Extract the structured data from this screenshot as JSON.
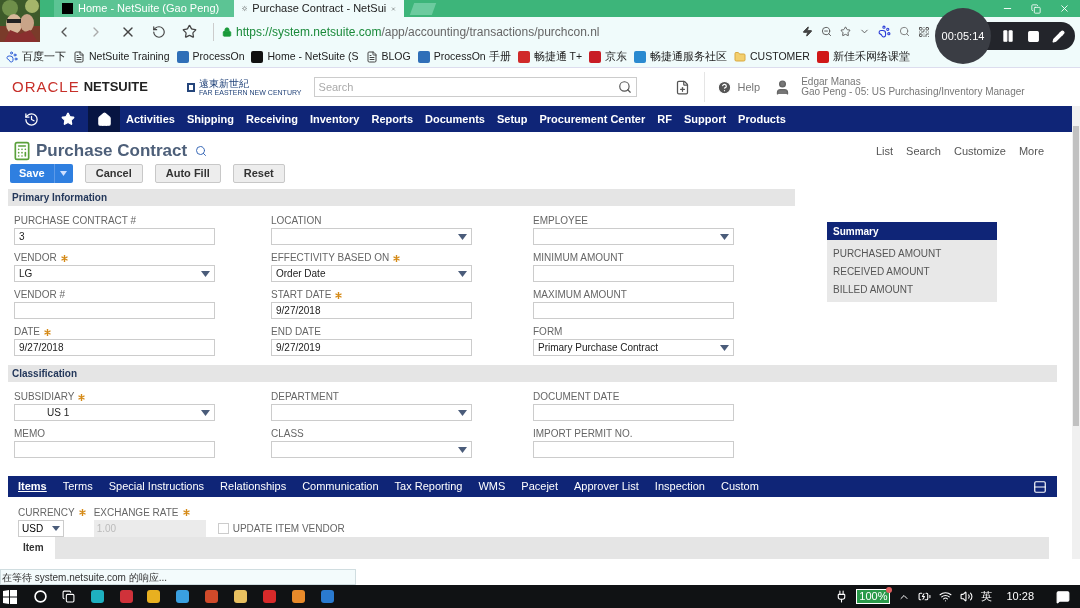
{
  "browser": {
    "tabs": [
      {
        "title": "Home - NetSuite (Gao Peng)",
        "selected": false,
        "loading": false
      },
      {
        "title": "Purchase Contract - NetSui",
        "selected": true,
        "loading": true
      }
    ],
    "url_host": "https://system.netsuite.com",
    "url_path": "/app/accounting/transactions/purchcon.nl",
    "bookmarks": [
      {
        "label": "百度一下",
        "kind": "paw"
      },
      {
        "label": "NetSuite Training",
        "kind": "doc"
      },
      {
        "label": "ProcessOn",
        "kind": "tile",
        "color": "#2f6fb8"
      },
      {
        "label": "Home - NetSuite (S",
        "kind": "tile",
        "color": "#111111"
      },
      {
        "label": "BLOG",
        "kind": "doc"
      },
      {
        "label": "ProcessOn 手册",
        "kind": "tile",
        "color": "#2f6fb8"
      },
      {
        "label": "畅捷通 T+",
        "kind": "tile",
        "color": "#d02a2a"
      },
      {
        "label": "京东",
        "kind": "tile",
        "color": "#c81d25"
      },
      {
        "label": "畅捷通服务社区",
        "kind": "tile",
        "color": "#2a8ad0"
      },
      {
        "label": "CUSTOMER",
        "kind": "folder"
      },
      {
        "label": "新佳禾网络课堂",
        "kind": "tile",
        "color": "#d01818"
      }
    ]
  },
  "recorder": {
    "time": "00:05:14"
  },
  "header": {
    "brand_left": "ORACLE",
    "brand_right": "NETSUITE",
    "company_cn": "遠東新世紀",
    "company_en": "FAR EASTERN NEW CENTURY",
    "search_placeholder": "Search",
    "help": "Help",
    "user_name": "Edgar Manas",
    "user_role": "Gao Peng - 05: US Purchasing/Inventory Manager"
  },
  "nav": {
    "home_selected": true,
    "items": [
      {
        "label": "Activities"
      },
      {
        "label": "Shipping"
      },
      {
        "label": "Receiving"
      },
      {
        "label": "Inventory"
      },
      {
        "label": "Reports"
      },
      {
        "label": "Documents"
      },
      {
        "label": "Setup"
      },
      {
        "label": "Procurement Center"
      },
      {
        "label": "RF"
      },
      {
        "label": "Support"
      },
      {
        "label": "Products"
      }
    ]
  },
  "page": {
    "title": "Purchase Contract",
    "links": [
      "List",
      "Search",
      "Customize",
      "More"
    ],
    "buttons": [
      {
        "label": "Save",
        "kind": "primary"
      },
      {
        "label": "Cancel",
        "kind": "plain"
      },
      {
        "label": "Auto Fill",
        "kind": "plain"
      },
      {
        "label": "Reset",
        "kind": "plain"
      }
    ]
  },
  "sections": [
    {
      "title": "Primary Information",
      "columns": [
        [
          {
            "label": "PURCHASE CONTRACT #",
            "kind": "text",
            "required": false,
            "value": "3"
          },
          {
            "label": "VENDOR",
            "kind": "select",
            "required": true,
            "value": "LG"
          },
          {
            "label": "VENDOR #",
            "kind": "text",
            "required": false
          },
          {
            "label": "DATE",
            "kind": "text",
            "required": true,
            "value": "9/27/2018"
          }
        ],
        [
          {
            "label": "LOCATION",
            "kind": "select",
            "required": false
          },
          {
            "label": "EFFECTIVITY BASED ON",
            "kind": "select",
            "required": true,
            "value": "Order Date"
          },
          {
            "label": "START DATE",
            "kind": "text",
            "required": true,
            "value": "9/27/2018"
          },
          {
            "label": "END DATE",
            "kind": "text",
            "required": false,
            "value": "9/27/2019"
          }
        ],
        [
          {
            "label": "EMPLOYEE",
            "kind": "select",
            "required": false
          },
          {
            "label": "MINIMUM AMOUNT",
            "kind": "text",
            "required": false
          },
          {
            "label": "MAXIMUM AMOUNT",
            "kind": "text",
            "required": false
          },
          {
            "label": "FORM",
            "kind": "select",
            "required": false,
            "value": "Primary Purchase Contract"
          }
        ]
      ]
    },
    {
      "title": "Classification",
      "columns": [
        [
          {
            "label": "SUBSIDIARY",
            "kind": "select",
            "required": true,
            "value": "US 1",
            "indented": true
          },
          {
            "label": "MEMO",
            "kind": "text",
            "required": false
          }
        ],
        [
          {
            "label": "DEPARTMENT",
            "kind": "select",
            "required": false
          },
          {
            "label": "CLASS",
            "kind": "select",
            "required": false
          }
        ],
        [
          {
            "label": "DOCUMENT DATE",
            "kind": "text",
            "required": false
          },
          {
            "label": "IMPORT PERMIT NO.",
            "kind": "text",
            "required": false
          }
        ]
      ]
    }
  ],
  "summary": {
    "title": "Summary",
    "items": [
      "PURCHASED AMOUNT",
      "RECEIVED AMOUNT",
      "BILLED AMOUNT"
    ]
  },
  "subtabs": [
    {
      "label": "Items",
      "selected": true
    },
    {
      "label": "Terms",
      "selected": false
    },
    {
      "label": "Special Instructions",
      "selected": false
    },
    {
      "label": "Relationships",
      "selected": false
    },
    {
      "label": "Communication",
      "selected": false
    },
    {
      "label": "Tax Reporting",
      "selected": false
    },
    {
      "label": "WMS",
      "selected": false
    },
    {
      "label": "Pacejet",
      "selected": false
    },
    {
      "label": "Approver List",
      "selected": false
    },
    {
      "label": "Inspection",
      "selected": false
    },
    {
      "label": "Custom",
      "selected": false
    }
  ],
  "items_tab": {
    "currency_label": "CURRENCY",
    "currency": "USD",
    "rate_label": "EXCHANGE RATE",
    "rate": "1.00",
    "rate_disabled": true,
    "update_label": "UPDATE ITEM VENDOR",
    "update_checked": false,
    "item_header": "Item"
  },
  "status_text": "在等待 system.netsuite.com 的响应...",
  "taskbar": {
    "battery": "100%",
    "ime": "英",
    "time": "10:28"
  }
}
